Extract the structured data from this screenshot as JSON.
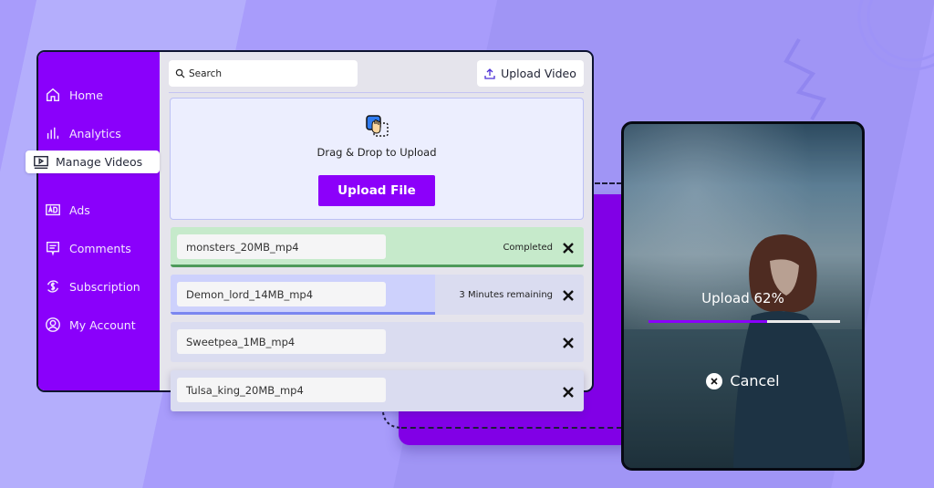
{
  "sidebar": {
    "items": [
      {
        "label": "Home",
        "icon": "home-icon"
      },
      {
        "label": "Analytics",
        "icon": "analytics-icon"
      },
      {
        "label": "Manage Videos",
        "icon": "video-icon",
        "active": true
      },
      {
        "label": "Ads",
        "icon": "ads-icon"
      },
      {
        "label": "Comments",
        "icon": "comment-icon"
      },
      {
        "label": "Subscription",
        "icon": "subscription-icon"
      },
      {
        "label": "My Account",
        "icon": "account-icon"
      }
    ]
  },
  "toolbar": {
    "search_placeholder": "Search",
    "upload_video_label": "Upload Video"
  },
  "dropzone": {
    "text": "Drag & Drop to Upload",
    "button_label": "Upload File"
  },
  "files": [
    {
      "name": "monsters_20MB_mp4",
      "status": "Completed",
      "state": "completed",
      "progress": 1.0
    },
    {
      "name": "Demon_lord_14MB_mp4",
      "status": "3 Minutes remaining",
      "state": "uploading",
      "progress": 0.64
    },
    {
      "name": "Sweetpea_1MB_mp4",
      "status": "",
      "state": "queued",
      "progress": 0
    },
    {
      "name": "Tulsa_king_20MB_mp4",
      "status": "",
      "state": "queued",
      "progress": 0
    }
  ],
  "preview": {
    "upload_label": "Upload 62%",
    "progress_percent": 62,
    "cancel_label": "Cancel"
  },
  "colors": {
    "accent": "#8a00fb",
    "background": "#a89cfb",
    "completed": "#c6eacb",
    "completed_bar": "#4e9a5a",
    "uploading_bar": "#7a86f0"
  }
}
